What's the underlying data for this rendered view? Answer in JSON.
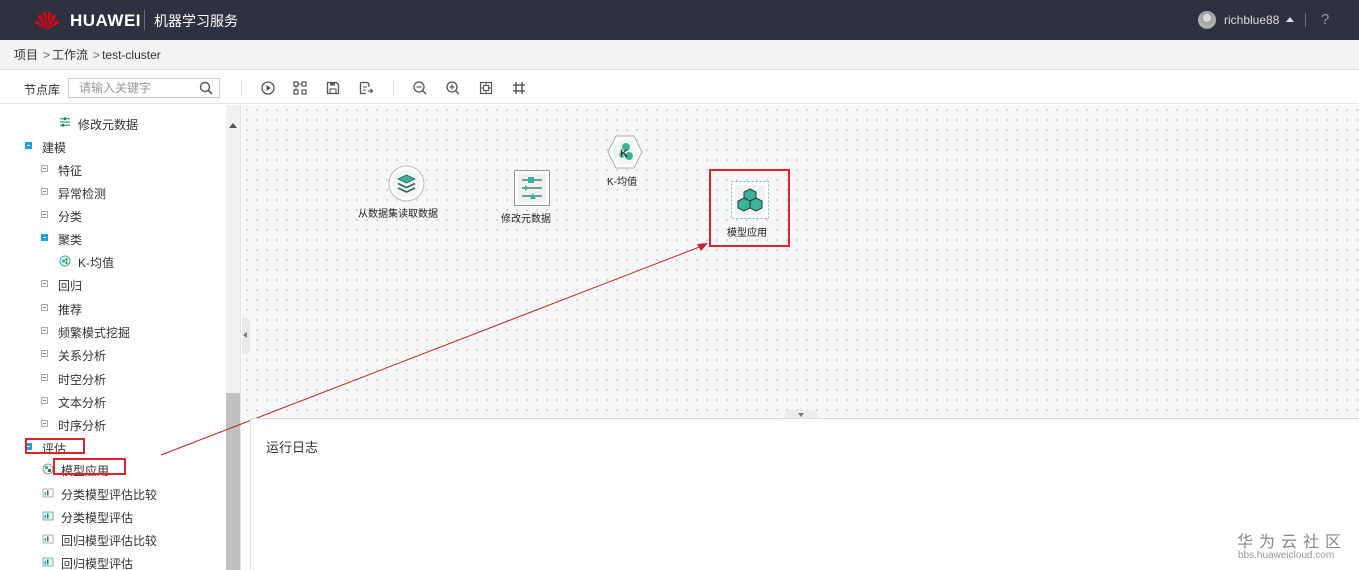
{
  "header": {
    "brand": "HUAWEI",
    "service_name": "机器学习服务",
    "username": "richblue88",
    "help": "?"
  },
  "breadcrumb": {
    "items": [
      "项目",
      "工作流",
      "test-cluster"
    ],
    "separator": ">"
  },
  "toolbar": {
    "node_library_label": "节点库",
    "search_placeholder": "请输入关键字",
    "icons": [
      "run-icon",
      "layout-icon",
      "save-icon",
      "save-as-icon",
      "zoom-out-icon",
      "zoom-in-icon",
      "fit-icon",
      "grid-icon"
    ]
  },
  "sidebar": {
    "items": [
      {
        "label": "修改元数据",
        "type": "leaf"
      },
      {
        "label": "建模",
        "type": "expanded"
      },
      {
        "label": "特征",
        "type": "collapsed"
      },
      {
        "label": "异常检测",
        "type": "collapsed"
      },
      {
        "label": "分类",
        "type": "collapsed"
      },
      {
        "label": "聚类",
        "type": "expanded"
      },
      {
        "label": "K-均值",
        "type": "leaf"
      },
      {
        "label": "回归",
        "type": "collapsed"
      },
      {
        "label": "推荐",
        "type": "collapsed"
      },
      {
        "label": "频繁模式挖掘",
        "type": "collapsed"
      },
      {
        "label": "关系分析",
        "type": "collapsed"
      },
      {
        "label": "时空分析",
        "type": "collapsed"
      },
      {
        "label": "文本分析",
        "type": "collapsed"
      },
      {
        "label": "时序分析",
        "type": "collapsed"
      },
      {
        "label": "评估",
        "type": "expanded"
      },
      {
        "label": "模型应用",
        "type": "leaf"
      },
      {
        "label": "分类模型评估比较",
        "type": "leaf"
      },
      {
        "label": "分类模型评估",
        "type": "leaf"
      },
      {
        "label": "回归模型评估比较",
        "type": "leaf"
      },
      {
        "label": "回归模型评估",
        "type": "leaf"
      }
    ]
  },
  "canvas": {
    "nodes": [
      {
        "label": "从数据集读取数据",
        "icon": "dataset-read-icon"
      },
      {
        "label": "修改元数据",
        "icon": "modify-metadata-icon"
      },
      {
        "label": "K-均值",
        "icon": "kmeans-icon"
      },
      {
        "label": "模型应用",
        "icon": "model-apply-icon"
      }
    ]
  },
  "log_panel": {
    "title": "运行日志"
  },
  "watermark": {
    "cn": "华为云社区",
    "en": "bbs.huaweicloud.com"
  },
  "colors": {
    "topbar_bg": "#2e3140",
    "accent_blue": "#1ea0d8",
    "highlight_red": "#d9262c",
    "node_teal": "#3bb39a"
  }
}
